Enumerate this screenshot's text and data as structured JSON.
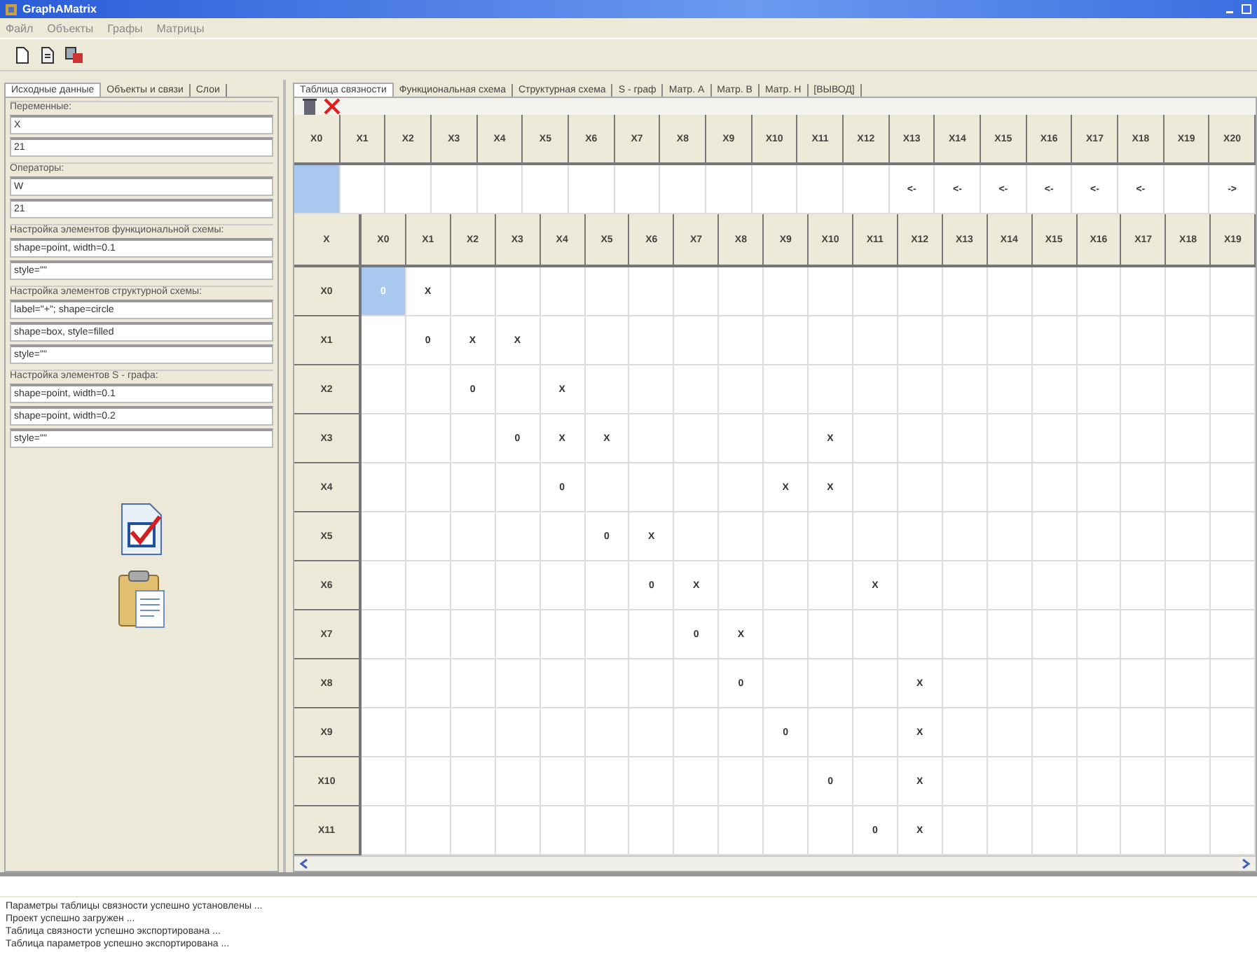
{
  "window": {
    "title": "GraphAMatrix"
  },
  "menu": [
    "Файл",
    "Объекты",
    "Графы",
    "Матрицы"
  ],
  "left_tabs": [
    {
      "label": "Исходные данные",
      "selected": true
    },
    {
      "label": "Объекты и связи",
      "selected": false
    },
    {
      "label": "Слои",
      "selected": false
    }
  ],
  "groups": [
    {
      "title": "Переменные:",
      "fields": [
        "X",
        "21"
      ]
    },
    {
      "title": "Операторы:",
      "fields": [
        "W",
        "21"
      ]
    },
    {
      "title": "Настройка элементов функциональной схемы:",
      "fields": [
        "shape=point, width=0.1",
        "style=\"\""
      ]
    },
    {
      "title": "Настройка элементов структурной схемы:",
      "fields": [
        "label=\"+\"; shape=circle",
        "shape=box, style=filled",
        "style=\"\""
      ]
    },
    {
      "title": "Настройка элементов S - графа:",
      "fields": [
        "shape=point, width=0.1",
        "shape=point, width=0.2",
        "style=\"\""
      ]
    }
  ],
  "right_tabs": [
    {
      "label": "Таблица связности",
      "selected": true
    },
    {
      "label": "Функциональная схема",
      "selected": false
    },
    {
      "label": "Структурная схема",
      "selected": false
    },
    {
      "label": "S - граф",
      "selected": false
    },
    {
      "label": "Матр. A",
      "selected": false
    },
    {
      "label": "Матр. B",
      "selected": false
    },
    {
      "label": "Матр. H",
      "selected": false
    },
    {
      "label": "[ВЫВОД]",
      "selected": false
    }
  ],
  "top_table": {
    "columns": [
      "X0",
      "X1",
      "X2",
      "X3",
      "X4",
      "X5",
      "X6",
      "X7",
      "X8",
      "X9",
      "X10",
      "X11",
      "X12",
      "X13",
      "X14",
      "X15",
      "X16",
      "X17",
      "X18",
      "X19",
      "X20"
    ],
    "cells": [
      {
        "selected": true
      },
      null,
      null,
      null,
      null,
      null,
      null,
      null,
      null,
      null,
      null,
      null,
      null,
      {
        "text": "<-",
        "selected": false
      },
      {
        "text": "<-",
        "selected": false
      },
      {
        "text": "<-",
        "selected": false
      },
      {
        "text": "<-",
        "selected": false
      },
      {
        "text": "<-",
        "selected": false
      },
      {
        "text": "<-",
        "selected": false
      },
      null,
      {
        "text": "->",
        "selected": false
      }
    ]
  },
  "matrix": {
    "corner": "X",
    "columns": [
      "X0",
      "X1",
      "X2",
      "X3",
      "X4",
      "X5",
      "X6",
      "X7",
      "X8",
      "X9",
      "X10",
      "X11",
      "X12",
      "X13",
      "X14",
      "X15",
      "X16",
      "X17",
      "X18",
      "X19"
    ],
    "rows": [
      {
        "label": "X0",
        "cells": [
          {
            "text": "0",
            "selected": true
          },
          {
            "text": "X",
            "selected": false
          },
          null,
          null,
          null,
          null,
          null,
          null,
          null,
          null,
          null,
          null,
          null,
          null,
          null,
          null,
          null,
          null,
          null,
          null
        ]
      },
      {
        "label": "X1",
        "cells": [
          null,
          {
            "text": "0",
            "selected": false
          },
          {
            "text": "X",
            "selected": false
          },
          {
            "text": "X",
            "selected": false
          },
          null,
          null,
          null,
          null,
          null,
          null,
          null,
          null,
          null,
          null,
          null,
          null,
          null,
          null,
          null,
          null
        ]
      },
      {
        "label": "X2",
        "cells": [
          null,
          null,
          {
            "text": "0",
            "selected": false
          },
          null,
          {
            "text": "X",
            "selected": false
          },
          null,
          null,
          null,
          null,
          null,
          null,
          null,
          null,
          null,
          null,
          null,
          null,
          null,
          null,
          null
        ]
      },
      {
        "label": "X3",
        "cells": [
          null,
          null,
          null,
          {
            "text": "0",
            "selected": false
          },
          {
            "text": "X",
            "selected": false
          },
          {
            "text": "X",
            "selected": false
          },
          null,
          null,
          null,
          null,
          {
            "text": "X",
            "selected": false
          },
          null,
          null,
          null,
          null,
          null,
          null,
          null,
          null,
          null
        ]
      },
      {
        "label": "X4",
        "cells": [
          null,
          null,
          null,
          null,
          {
            "text": "0",
            "selected": false
          },
          null,
          null,
          null,
          null,
          {
            "text": "X",
            "selected": false
          },
          {
            "text": "X",
            "selected": false
          },
          null,
          null,
          null,
          null,
          null,
          null,
          null,
          null,
          null
        ]
      },
      {
        "label": "X5",
        "cells": [
          null,
          null,
          null,
          null,
          null,
          {
            "text": "0",
            "selected": false
          },
          {
            "text": "X",
            "selected": false
          },
          null,
          null,
          null,
          null,
          null,
          null,
          null,
          null,
          null,
          null,
          null,
          null,
          null
        ]
      },
      {
        "label": "X6",
        "cells": [
          null,
          null,
          null,
          null,
          null,
          null,
          {
            "text": "0",
            "selected": false
          },
          {
            "text": "X",
            "selected": false
          },
          null,
          null,
          null,
          {
            "text": "X",
            "selected": false
          },
          null,
          null,
          null,
          null,
          null,
          null,
          null,
          null
        ]
      },
      {
        "label": "X7",
        "cells": [
          null,
          null,
          null,
          null,
          null,
          null,
          null,
          {
            "text": "0",
            "selected": false
          },
          {
            "text": "X",
            "selected": false
          },
          null,
          null,
          null,
          null,
          null,
          null,
          null,
          null,
          null,
          null,
          null
        ]
      },
      {
        "label": "X8",
        "cells": [
          null,
          null,
          null,
          null,
          null,
          null,
          null,
          null,
          {
            "text": "0",
            "selected": false
          },
          null,
          null,
          null,
          {
            "text": "X",
            "selected": false
          },
          null,
          null,
          null,
          null,
          null,
          null,
          null
        ]
      },
      {
        "label": "X9",
        "cells": [
          null,
          null,
          null,
          null,
          null,
          null,
          null,
          null,
          null,
          {
            "text": "0",
            "selected": false
          },
          null,
          null,
          {
            "text": "X",
            "selected": false
          },
          null,
          null,
          null,
          null,
          null,
          null,
          null
        ]
      },
      {
        "label": "X10",
        "cells": [
          null,
          null,
          null,
          null,
          null,
          null,
          null,
          null,
          null,
          null,
          {
            "text": "0",
            "selected": false
          },
          null,
          {
            "text": "X",
            "selected": false
          },
          null,
          null,
          null,
          null,
          null,
          null,
          null
        ]
      },
      {
        "label": "X11",
        "cells": [
          null,
          null,
          null,
          null,
          null,
          null,
          null,
          null,
          null,
          null,
          null,
          {
            "text": "0",
            "selected": false
          },
          {
            "text": "X",
            "selected": false
          },
          null,
          null,
          null,
          null,
          null,
          null,
          null
        ]
      }
    ]
  },
  "log": [
    "Параметры таблицы связности успешно установлены ...",
    "Проект успешно загружен ...",
    "Таблица связности успешно экспортирована ...",
    "Таблица параметров успешно экспортирована ..."
  ]
}
